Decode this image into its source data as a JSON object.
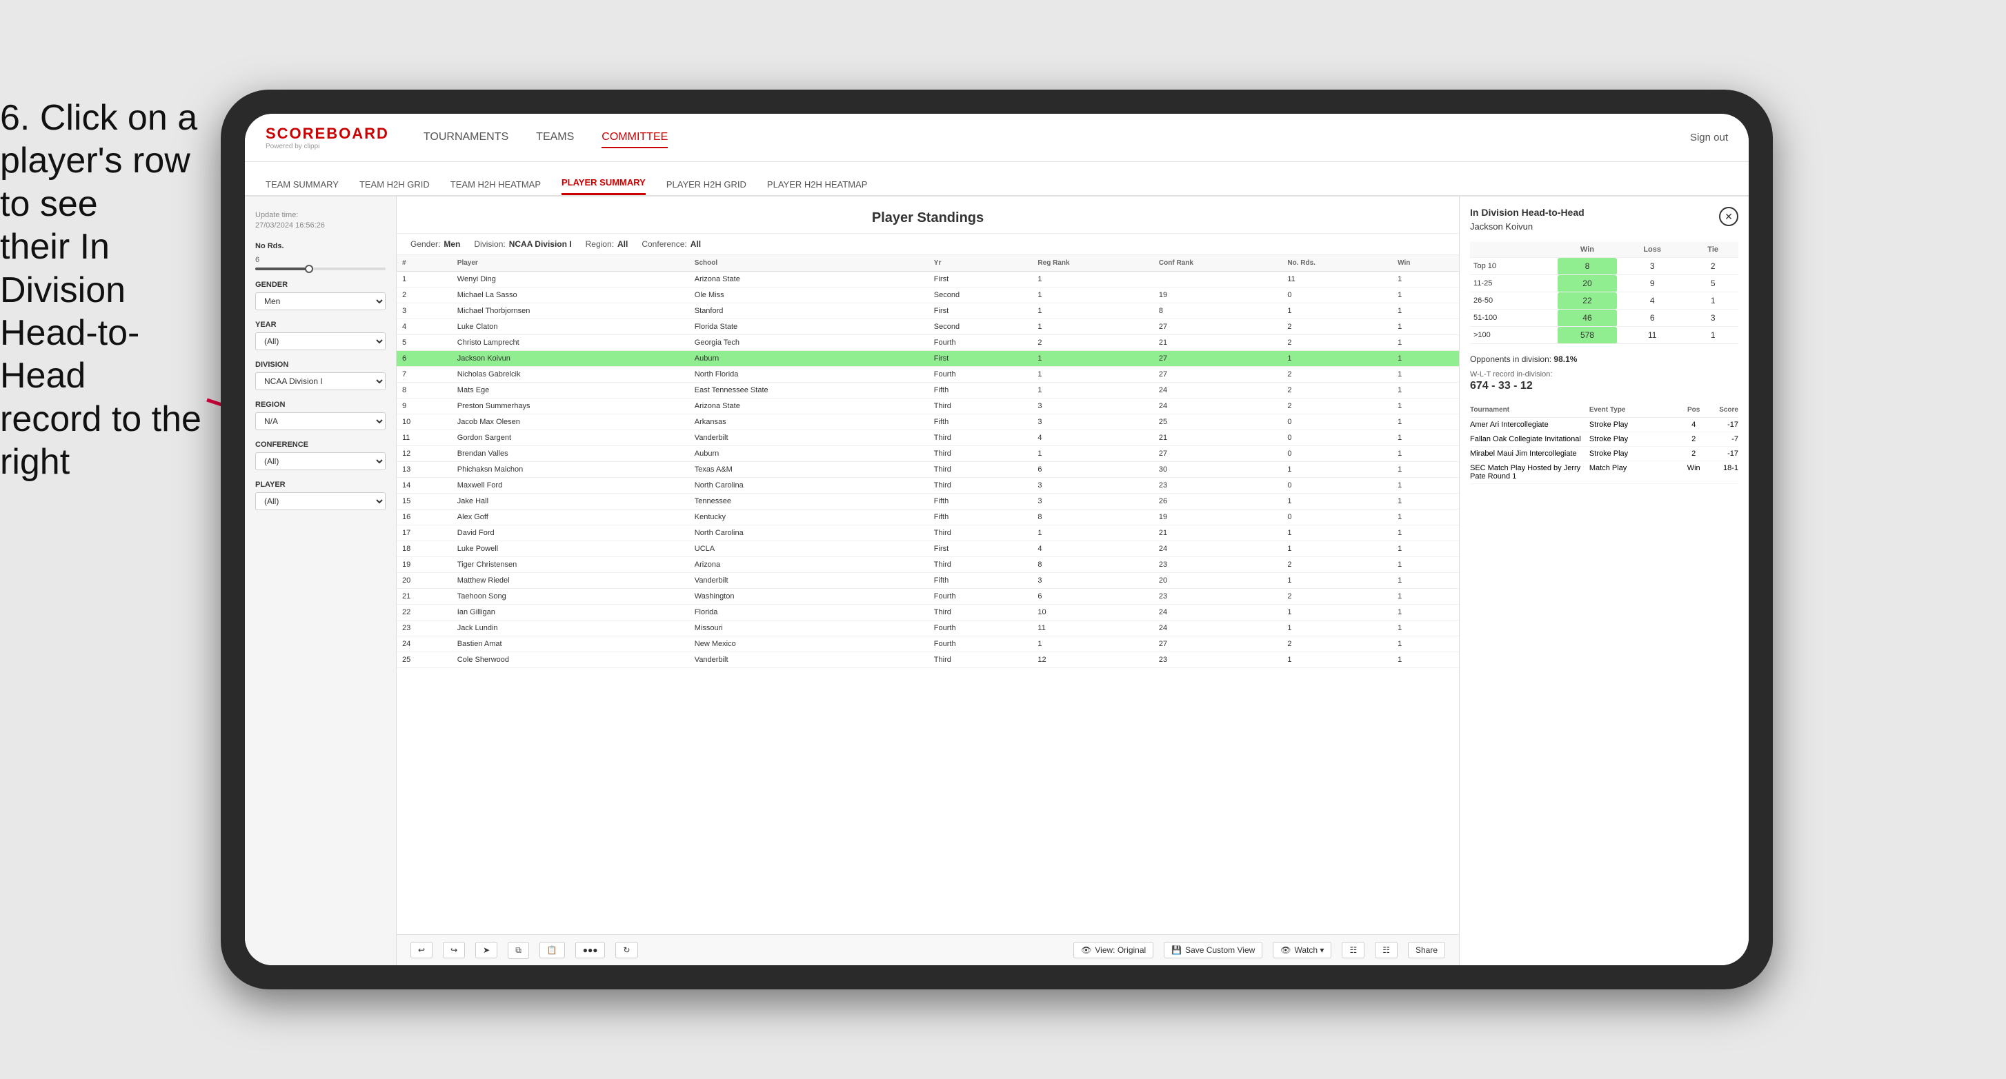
{
  "instruction": {
    "line1": "6. Click on a",
    "line2": "player's row to see",
    "line3": "their In Division",
    "line4": "Head-to-Head",
    "line5": "record to the right"
  },
  "nav": {
    "logo_main": "SCOREBOARD",
    "logo_sub": "Powered by clippi",
    "items": [
      "TOURNAMENTS",
      "TEAMS",
      "COMMITTEE"
    ],
    "sign_out": "Sign out"
  },
  "sub_nav": {
    "items": [
      "TEAM SUMMARY",
      "TEAM H2H GRID",
      "TEAM H2H HEATMAP",
      "PLAYER SUMMARY",
      "PLAYER H2H GRID",
      "PLAYER H2H HEATMAP"
    ],
    "active": "PLAYER SUMMARY"
  },
  "sidebar": {
    "update_label": "Update time:",
    "update_time": "27/03/2024 16:56:26",
    "no_rds_label": "No Rds.",
    "no_rds_value": "6",
    "gender_label": "Gender",
    "gender_value": "Men",
    "year_label": "Year",
    "year_value": "(All)",
    "division_label": "Division",
    "division_value": "NCAA Division I",
    "region_label": "Region",
    "region_value": "N/A",
    "conference_label": "Conference",
    "conference_value": "(All)",
    "player_label": "Player",
    "player_value": "(All)"
  },
  "standings": {
    "title": "Player Standings",
    "filters": {
      "gender": "Men",
      "division": "NCAA Division I",
      "region": "All",
      "conference": "All"
    },
    "columns": [
      "#",
      "Player",
      "School",
      "Yr",
      "Reg Rank",
      "Conf Rank",
      "No. Rds.",
      "Win"
    ],
    "rows": [
      {
        "num": 1,
        "player": "Wenyi Ding",
        "school": "Arizona State",
        "yr": "First",
        "reg": 1,
        "conf": "",
        "rds": 11,
        "win": 1
      },
      {
        "num": 2,
        "player": "Michael La Sasso",
        "school": "Ole Miss",
        "yr": "Second",
        "reg": 1,
        "conf": 19,
        "rds": 0,
        "win": 1
      },
      {
        "num": 3,
        "player": "Michael Thorbjornsen",
        "school": "Stanford",
        "yr": "First",
        "reg": 1,
        "conf": 8,
        "rds": 1,
        "win": 1
      },
      {
        "num": 4,
        "player": "Luke Claton",
        "school": "Florida State",
        "yr": "Second",
        "reg": 1,
        "conf": 27,
        "rds": 2,
        "win": 1
      },
      {
        "num": 5,
        "player": "Christo Lamprecht",
        "school": "Georgia Tech",
        "yr": "Fourth",
        "reg": 2,
        "conf": 21,
        "rds": 2,
        "win": 1
      },
      {
        "num": 6,
        "player": "Jackson Koivun",
        "school": "Auburn",
        "yr": "First",
        "reg": 1,
        "conf": 27,
        "rds": 1,
        "win": 1,
        "selected": true
      },
      {
        "num": 7,
        "player": "Nicholas Gabrelcik",
        "school": "North Florida",
        "yr": "Fourth",
        "reg": 1,
        "conf": 27,
        "rds": 2,
        "win": 1
      },
      {
        "num": 8,
        "player": "Mats Ege",
        "school": "East Tennessee State",
        "yr": "Fifth",
        "reg": 1,
        "conf": 24,
        "rds": 2,
        "win": 1
      },
      {
        "num": 9,
        "player": "Preston Summerhays",
        "school": "Arizona State",
        "yr": "Third",
        "reg": 3,
        "conf": 24,
        "rds": 2,
        "win": 1
      },
      {
        "num": 10,
        "player": "Jacob Max Olesen",
        "school": "Arkansas",
        "yr": "Fifth",
        "reg": 3,
        "conf": 25,
        "rds": 0,
        "win": 1
      },
      {
        "num": 11,
        "player": "Gordon Sargent",
        "school": "Vanderbilt",
        "yr": "Third",
        "reg": 4,
        "conf": 21,
        "rds": 0,
        "win": 1
      },
      {
        "num": 12,
        "player": "Brendan Valles",
        "school": "Auburn",
        "yr": "Third",
        "reg": 1,
        "conf": 27,
        "rds": 0,
        "win": 1
      },
      {
        "num": 13,
        "player": "Phichaksn Maichon",
        "school": "Texas A&M",
        "yr": "Third",
        "reg": 6,
        "conf": 30,
        "rds": 1,
        "win": 1
      },
      {
        "num": 14,
        "player": "Maxwell Ford",
        "school": "North Carolina",
        "yr": "Third",
        "reg": 3,
        "conf": 23,
        "rds": 0,
        "win": 1
      },
      {
        "num": 15,
        "player": "Jake Hall",
        "school": "Tennessee",
        "yr": "Fifth",
        "reg": 3,
        "conf": 26,
        "rds": 1,
        "win": 1
      },
      {
        "num": 16,
        "player": "Alex Goff",
        "school": "Kentucky",
        "yr": "Fifth",
        "reg": 8,
        "conf": 19,
        "rds": 0,
        "win": 1
      },
      {
        "num": 17,
        "player": "David Ford",
        "school": "North Carolina",
        "yr": "Third",
        "reg": 1,
        "conf": 21,
        "rds": 1,
        "win": 1
      },
      {
        "num": 18,
        "player": "Luke Powell",
        "school": "UCLA",
        "yr": "First",
        "reg": 4,
        "conf": 24,
        "rds": 1,
        "win": 1
      },
      {
        "num": 19,
        "player": "Tiger Christensen",
        "school": "Arizona",
        "yr": "Third",
        "reg": 8,
        "conf": 23,
        "rds": 2,
        "win": 1
      },
      {
        "num": 20,
        "player": "Matthew Riedel",
        "school": "Vanderbilt",
        "yr": "Fifth",
        "reg": 3,
        "conf": 20,
        "rds": 1,
        "win": 1
      },
      {
        "num": 21,
        "player": "Taehoon Song",
        "school": "Washington",
        "yr": "Fourth",
        "reg": 6,
        "conf": 23,
        "rds": 2,
        "win": 1
      },
      {
        "num": 22,
        "player": "Ian Gilligan",
        "school": "Florida",
        "yr": "Third",
        "reg": 10,
        "conf": 24,
        "rds": 1,
        "win": 1
      },
      {
        "num": 23,
        "player": "Jack Lundin",
        "school": "Missouri",
        "yr": "Fourth",
        "reg": 11,
        "conf": 24,
        "rds": 1,
        "win": 1
      },
      {
        "num": 24,
        "player": "Bastien Amat",
        "school": "New Mexico",
        "yr": "Fourth",
        "reg": 1,
        "conf": 27,
        "rds": 2,
        "win": 1
      },
      {
        "num": 25,
        "player": "Cole Sherwood",
        "school": "Vanderbilt",
        "yr": "Third",
        "reg": 12,
        "conf": 23,
        "rds": 1,
        "win": 1
      }
    ]
  },
  "h2h": {
    "title": "In Division Head-to-Head",
    "player": "Jackson Koivun",
    "table_headers": [
      "",
      "Win",
      "Loss",
      "Tie"
    ],
    "rows": [
      {
        "label": "Top 10",
        "win": 8,
        "loss": 3,
        "tie": 2
      },
      {
        "label": "11-25",
        "win": 20,
        "loss": 9,
        "tie": 5
      },
      {
        "label": "26-50",
        "win": 22,
        "loss": 4,
        "tie": 1
      },
      {
        "label": "51-100",
        "win": 46,
        "loss": 6,
        "tie": 3
      },
      {
        "label": ">100",
        "win": 578,
        "loss": 11,
        "tie": 1
      }
    ],
    "opponents_label": "Opponents in division:",
    "record_label": "W-L-T record in-division:",
    "opponents_pct": "98.1%",
    "record": "674 - 33 - 12",
    "tournaments_header": [
      "Tournament",
      "Event Type",
      "Pos",
      "Score"
    ],
    "tournaments": [
      {
        "name": "Amer Ari Intercollegiate",
        "type": "Stroke Play",
        "pos": 4,
        "score": "-17"
      },
      {
        "name": "Fallan Oak Collegiate Invitational",
        "type": "Stroke Play",
        "pos": 2,
        "score": "-7"
      },
      {
        "name": "Mirabel Maui Jim Intercollegiate",
        "type": "Stroke Play",
        "pos": 2,
        "score": "-17"
      },
      {
        "name": "SEC Match Play Hosted by Jerry Pate Round 1",
        "type": "Match Play",
        "pos": "Win",
        "score": "18-1"
      }
    ]
  },
  "toolbar": {
    "view_original": "View: Original",
    "save_custom": "Save Custom View",
    "watch": "Watch ▾",
    "share": "Share"
  }
}
